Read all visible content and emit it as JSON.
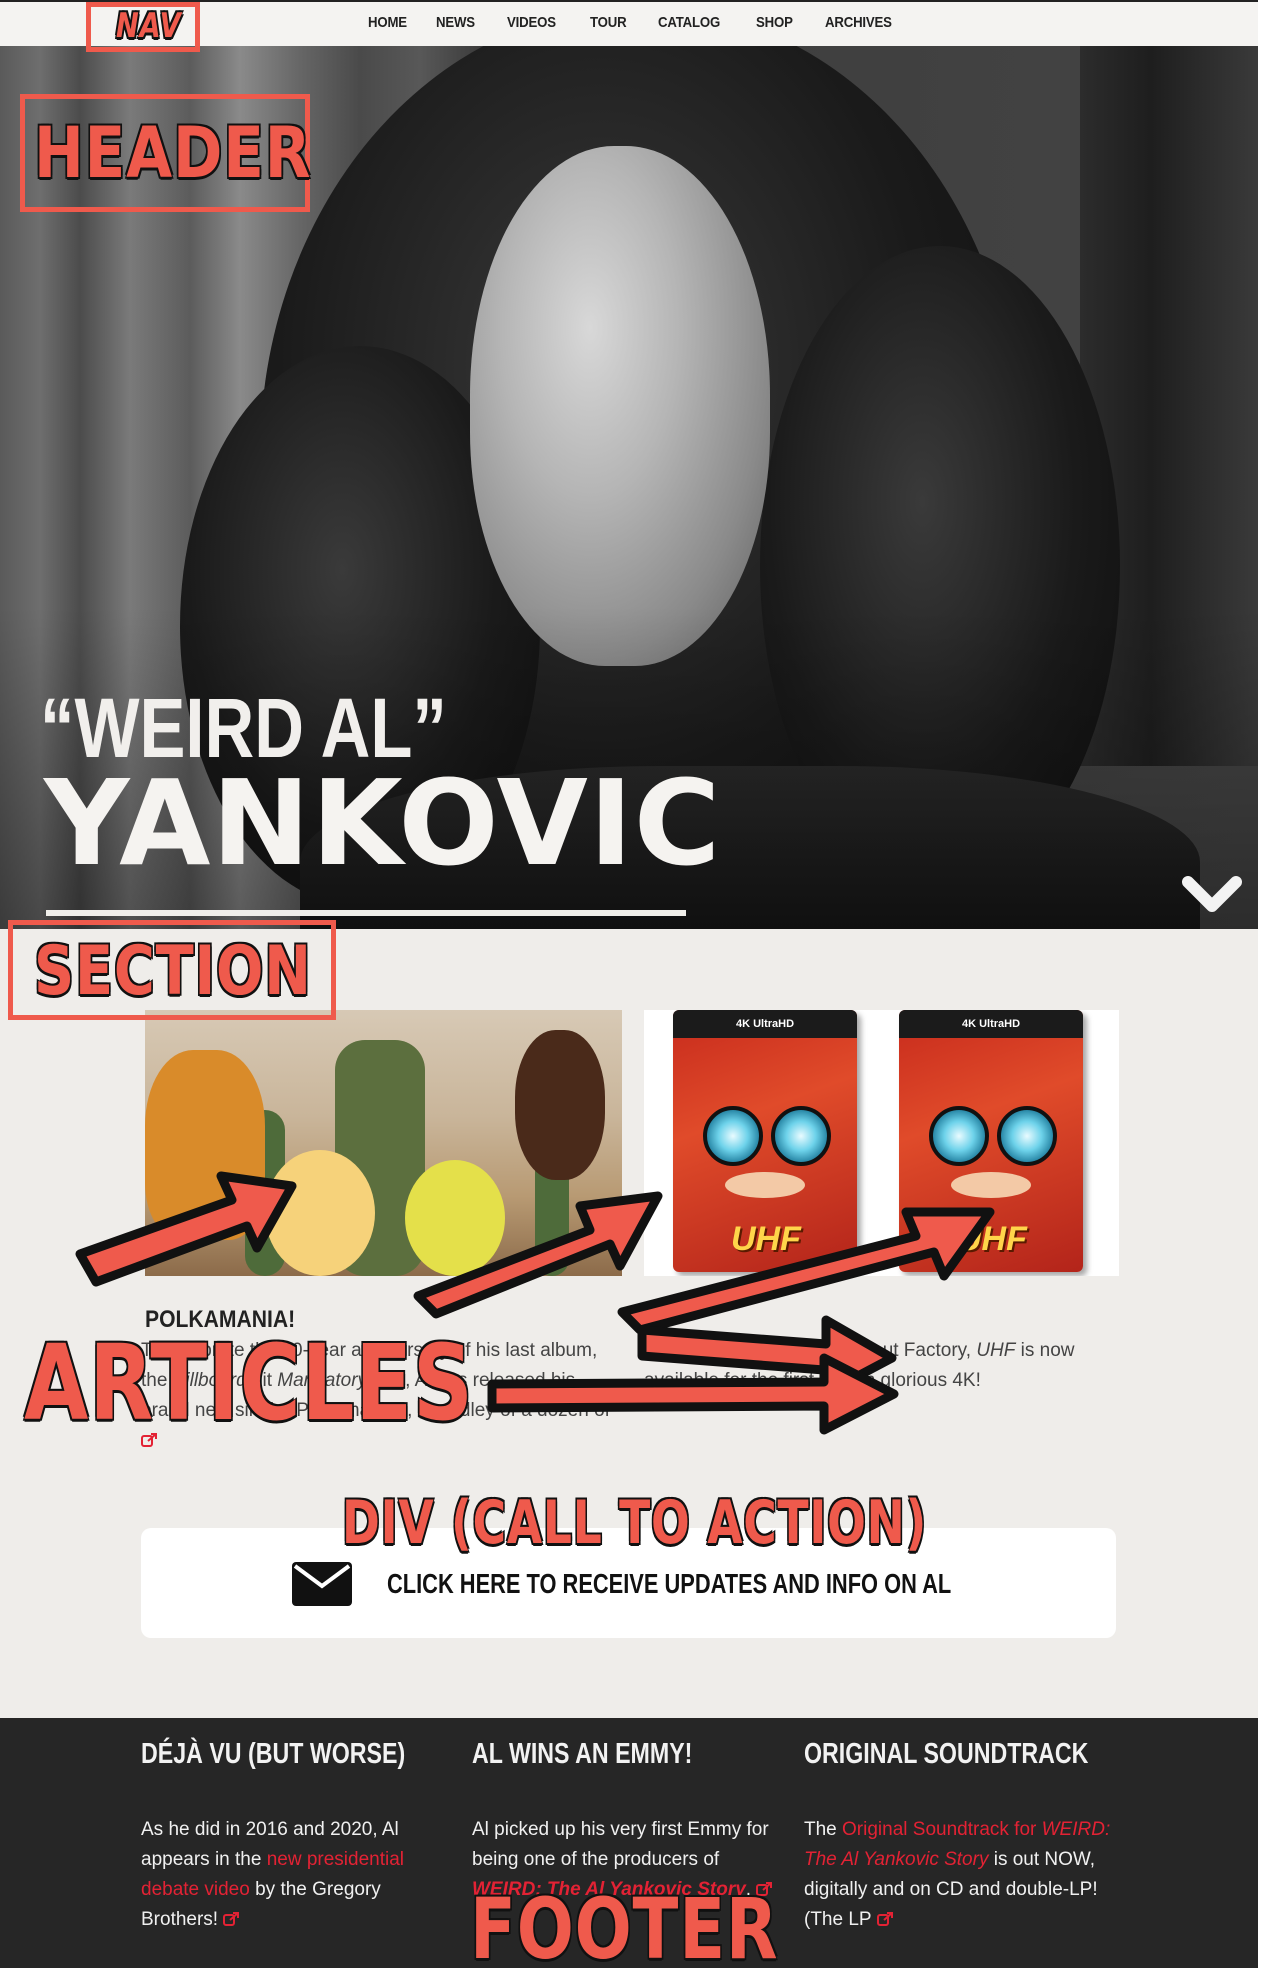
{
  "nav": {
    "items": [
      "HOME",
      "NEWS",
      "VIDEOS",
      "TOUR",
      "CATALOG",
      "SHOP",
      "ARCHIVES"
    ]
  },
  "header": {
    "title_line1": "“WEIRD AL”",
    "title_line2": "YANKOVIC"
  },
  "articles": [
    {
      "title": "POLKAMANIA!",
      "text_parts": [
        "To celebrate the 40-year anniversary of his last album, the ",
        "Billboard",
        " hit ",
        "Mandatory Fun",
        ", Al has released his brand new single “Polkamania!”, a medley of a dozen of "
      ]
    },
    {
      "text_parts": [
        "Thanks to our friends at Shout Factory, ",
        "UHF",
        " is now available for the first time in glorious 4K!"
      ],
      "box_label": "4K UltraHD",
      "box_title": "UHF"
    }
  ],
  "cta": {
    "label": "CLICK HERE TO RECEIVE UPDATES AND INFO ON AL"
  },
  "footer": {
    "columns": [
      {
        "title": "DÉJÀ VU (BUT WORSE)",
        "text_a": "As he did in 2016 and 2020, Al appears in the ",
        "link": "new presidential debate video",
        "text_b": " by the Gregory Brothers! "
      },
      {
        "title": "AL WINS AN EMMY!",
        "text_a": "Al picked up his very first Emmy for being one of the producers of ",
        "link": "WEIRD: The Al Yankovic Story",
        "text_b": ", "
      },
      {
        "title": "ORIGINAL SOUNDTRACK",
        "text_a": "The ",
        "link1": "Original Soundtrack for ",
        "link2": "WEIRD: The Al Yankovic Story",
        "text_b": " is out NOW, digitally and on CD and double-LP! (The LP "
      }
    ]
  },
  "annotations": {
    "nav": "NAV",
    "header": "HEADER",
    "section": "SECTION",
    "articles": "ARTICLES",
    "div": "DIV (CALL TO ACTION)",
    "footer": "FOOTER"
  },
  "colors": {
    "accent": "#e32234",
    "annotation": "#ef5a4c",
    "footer_bg": "#262626",
    "section_bg": "#efedea"
  },
  "icons": [
    "chevron-down-icon",
    "envelope-icon",
    "external-link-icon"
  ]
}
